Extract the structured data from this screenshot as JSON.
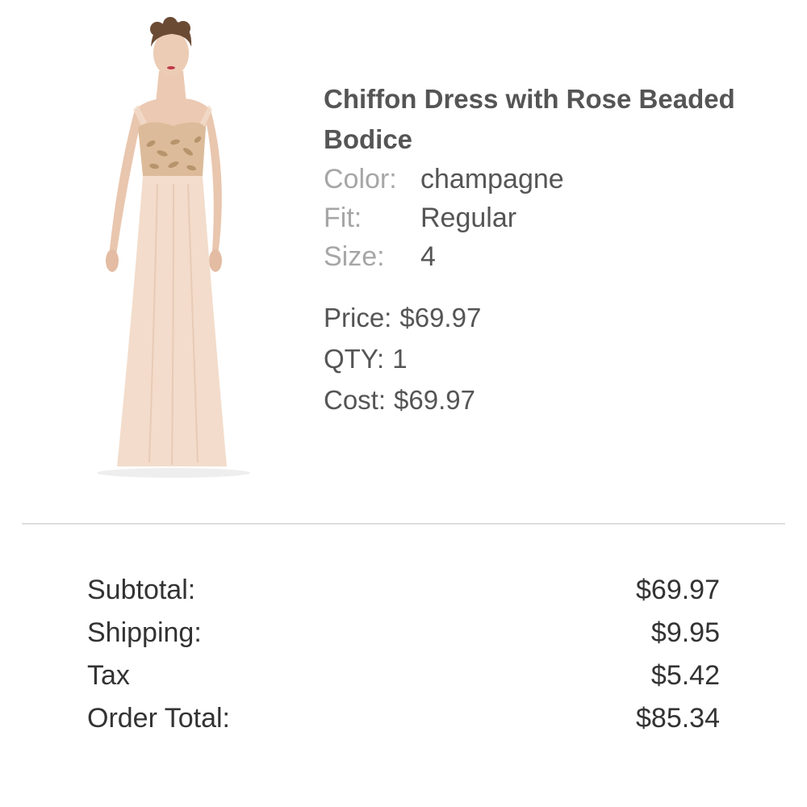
{
  "product": {
    "image_alt": "Chiffon Dress with Rose Beaded Bodice",
    "title": "Chiffon Dress with Rose Beaded Bodice",
    "attributes": [
      {
        "label": "Color:",
        "value": "champagne"
      },
      {
        "label": "Fit:",
        "value": "Regular"
      },
      {
        "label": "Size:",
        "value": "4"
      }
    ],
    "price_label": "Price:",
    "price_value": "$69.97",
    "qty_label": "QTY:",
    "qty_value": "1",
    "cost_label": "Cost:",
    "cost_value": "$69.97"
  },
  "summary": {
    "rows": [
      {
        "label": "Subtotal:",
        "value": "$69.97"
      },
      {
        "label": "Shipping:",
        "value": "$9.95"
      },
      {
        "label": "Tax",
        "value": "$5.42"
      },
      {
        "label": "Order Total:",
        "value": "$85.34"
      }
    ]
  },
  "colors": {
    "dress": "#f3dccb",
    "label_gray": "#a6a6a6",
    "text_dark": "#555555",
    "divider": "#dedede"
  }
}
